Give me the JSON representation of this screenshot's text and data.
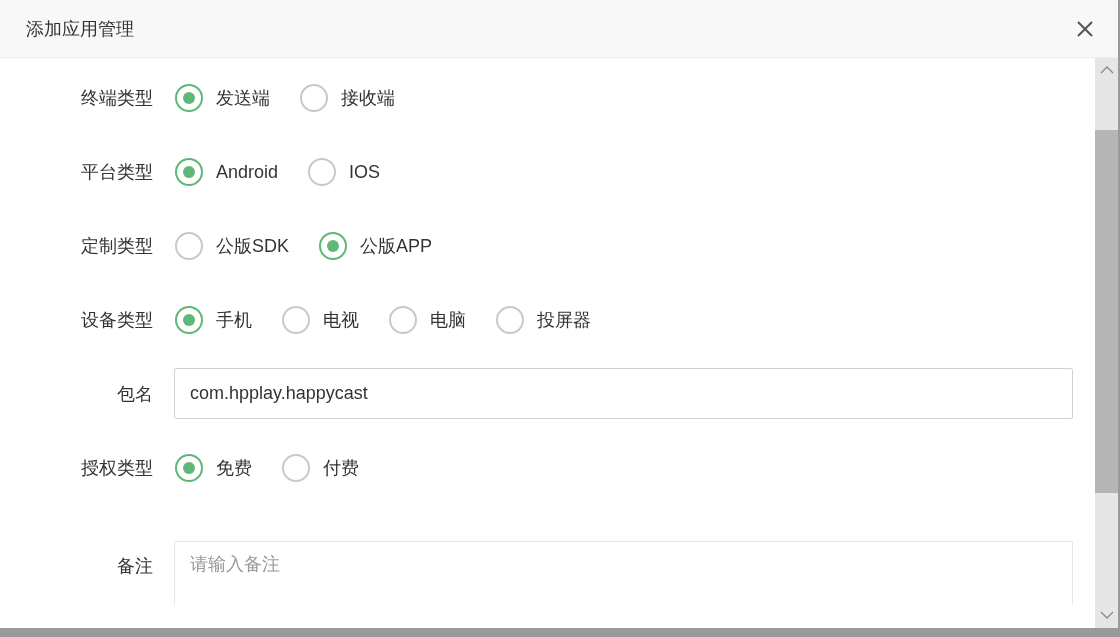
{
  "dialog": {
    "title": "添加应用管理"
  },
  "form": {
    "rows": [
      {
        "kind": "radio",
        "label": "终端类型",
        "options": [
          {
            "label": "发送端",
            "selected": true
          },
          {
            "label": "接收端",
            "selected": false
          }
        ]
      },
      {
        "kind": "radio",
        "label": "平台类型",
        "options": [
          {
            "label": "Android",
            "selected": true
          },
          {
            "label": "IOS",
            "selected": false
          }
        ]
      },
      {
        "kind": "radio",
        "label": "定制类型",
        "options": [
          {
            "label": "公版SDK",
            "selected": false
          },
          {
            "label": "公版APP",
            "selected": true
          }
        ]
      },
      {
        "kind": "radio",
        "label": "设备类型",
        "options": [
          {
            "label": "手机",
            "selected": true
          },
          {
            "label": "电视",
            "selected": false
          },
          {
            "label": "电脑",
            "selected": false
          },
          {
            "label": "投屏器",
            "selected": false
          }
        ]
      },
      {
        "kind": "input",
        "label": "包名",
        "value": "com.hpplay.happycast"
      },
      {
        "kind": "radio",
        "label": "授权类型",
        "options": [
          {
            "label": "免费",
            "selected": true
          },
          {
            "label": "付费",
            "selected": false
          }
        ]
      },
      {
        "kind": "textarea",
        "label": "备注",
        "placeholder": "请输入备注"
      }
    ]
  }
}
